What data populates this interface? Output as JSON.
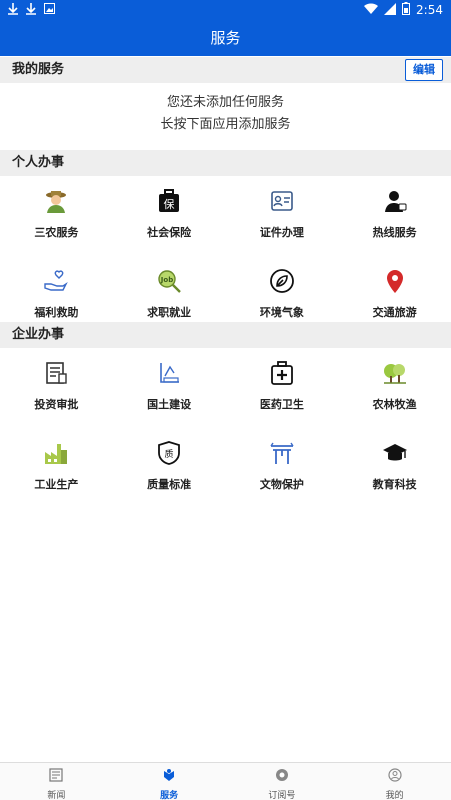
{
  "status_bar": {
    "time": "2:54"
  },
  "app_bar": {
    "title": "服务"
  },
  "my_services": {
    "title": "我的服务",
    "edit_label": "编辑",
    "empty_line1": "您还未添加任何服务",
    "empty_line2": "长按下面应用添加服务"
  },
  "personal": {
    "title": "个人办事",
    "items": [
      {
        "label": "三农服务",
        "icon": "farmer-icon"
      },
      {
        "label": "社会保险",
        "icon": "insurance-bag-icon"
      },
      {
        "label": "证件办理",
        "icon": "id-card-icon"
      },
      {
        "label": "热线服务",
        "icon": "hotline-person-icon"
      },
      {
        "label": "福利救助",
        "icon": "welfare-hand-heart-icon"
      },
      {
        "label": "求职就业",
        "icon": "job-search-icon"
      },
      {
        "label": "环境气象",
        "icon": "leaf-circle-icon"
      },
      {
        "label": "交通旅游",
        "icon": "map-pin-icon"
      }
    ]
  },
  "enterprise": {
    "title": "企业办事",
    "items": [
      {
        "label": "投资审批",
        "icon": "document-approval-icon"
      },
      {
        "label": "国土建设",
        "icon": "land-construction-icon"
      },
      {
        "label": "医药卫生",
        "icon": "medical-kit-icon"
      },
      {
        "label": "农林牧渔",
        "icon": "trees-icon"
      },
      {
        "label": "工业生产",
        "icon": "factory-icon"
      },
      {
        "label": "质量标准",
        "icon": "quality-shield-icon"
      },
      {
        "label": "文物保护",
        "icon": "heritage-gate-icon"
      },
      {
        "label": "教育科技",
        "icon": "graduation-cap-icon"
      }
    ]
  },
  "bottom_nav": [
    {
      "label": "新闻",
      "icon": "news-icon",
      "active": false
    },
    {
      "label": "服务",
      "icon": "service-icon",
      "active": true
    },
    {
      "label": "订阅号",
      "icon": "subscription-icon",
      "active": false
    },
    {
      "label": "我的",
      "icon": "profile-icon",
      "active": false
    }
  ],
  "colors": {
    "primary": "#0a5dd8",
    "section_bg": "#eeeeee"
  }
}
